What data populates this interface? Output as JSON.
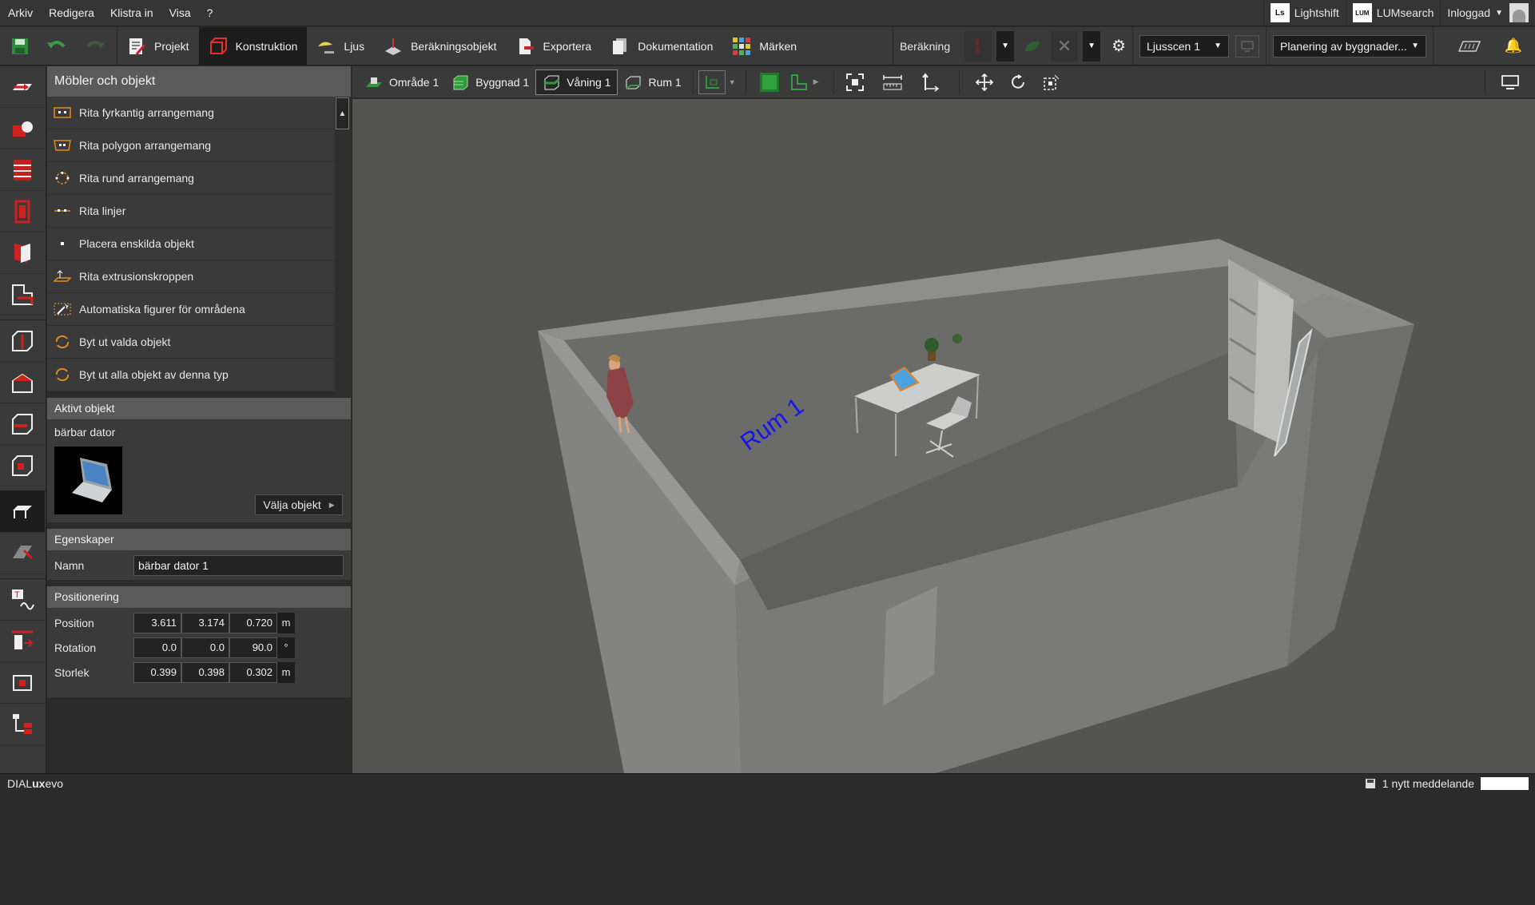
{
  "menu": [
    "Arkiv",
    "Redigera",
    "Klistra in",
    "Visa",
    "?"
  ],
  "topright": {
    "lightshift_logo": "Ls",
    "lightshift": "Lightshift",
    "lumsearch_logo": "LUM",
    "lumsearch": "LUMsearch",
    "login": "Inloggad"
  },
  "ribbon": {
    "tabs": [
      "Projekt",
      "Konstruktion",
      "Ljus",
      "Beräkningsobjekt",
      "Exportera",
      "Dokumentation",
      "Märken"
    ],
    "active_tab": "Konstruktion",
    "calc_label": "Beräkning",
    "scene_select": "Ljusscen 1",
    "planning_select": "Planering av byggnader..."
  },
  "panel": {
    "header": "Möbler och objekt",
    "items": [
      {
        "label": "Rita fyrkantig arrangemang",
        "icon": "rect-arrangement-icon"
      },
      {
        "label": "Rita polygon arrangemang",
        "icon": "polygon-arrangement-icon"
      },
      {
        "label": "Rita rund arrangemang",
        "icon": "round-arrangement-icon"
      },
      {
        "label": "Rita linjer",
        "icon": "line-arrangement-icon"
      },
      {
        "label": "Placera enskilda objekt",
        "icon": "single-object-icon"
      },
      {
        "label": "Rita extrusionskroppen",
        "icon": "extrusion-icon"
      },
      {
        "label": "Automatiska figurer för områdena",
        "icon": "magic-wand-icon"
      },
      {
        "label": "Byt ut valda objekt",
        "icon": "replace-icon"
      },
      {
        "label": "Byt ut alla objekt av denna typ",
        "icon": "replace-all-icon"
      }
    ],
    "active_object_header": "Aktivt objekt",
    "active_object_name": "bärbar dator",
    "choose_object": "Välja objekt",
    "properties_header": "Egenskaper",
    "name_label": "Namn",
    "name_value": "bärbar dator 1",
    "positioning_header": "Positionering",
    "position": {
      "label": "Position",
      "x": "3.611",
      "y": "3.174",
      "z": "0.720",
      "unit": "m"
    },
    "rotation": {
      "label": "Rotation",
      "x": "0.0",
      "y": "0.0",
      "z": "90.0",
      "unit": "°"
    },
    "size": {
      "label": "Storlek",
      "x": "0.399",
      "y": "0.398",
      "z": "0.302",
      "unit": "m"
    }
  },
  "viewtools": {
    "crumbs": [
      "Område 1",
      "Byggnad 1",
      "Våning 1",
      "Rum 1"
    ],
    "active_crumb": "Våning 1"
  },
  "viewport": {
    "room_label": "Rum 1"
  },
  "status": {
    "app_name_a": "DIAL",
    "app_name_b": "ux",
    "app_name_c": "evo",
    "message": "1 nytt meddelande"
  }
}
